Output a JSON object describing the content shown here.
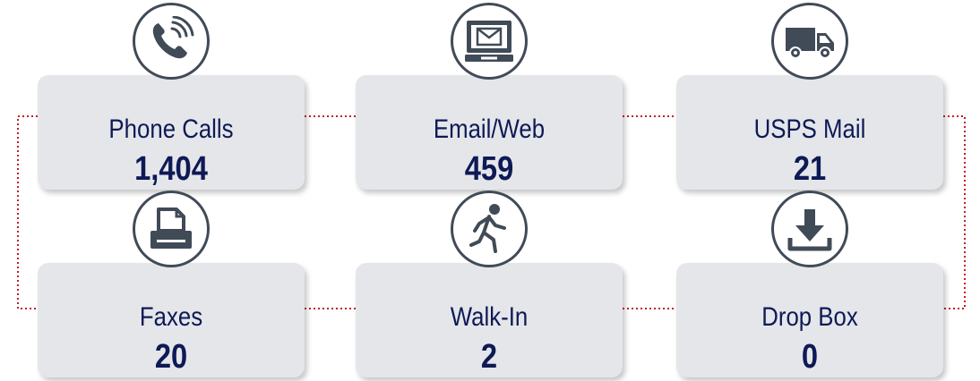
{
  "colors": {
    "card_background": "#e5e6ea",
    "text": "#0d1a55",
    "icon": "#414b57",
    "connector": "#c0202a"
  },
  "channels": [
    {
      "label": "Phone Calls",
      "value": "1,404",
      "icon": "phone-icon"
    },
    {
      "label": "Email/Web",
      "value": "459",
      "icon": "email-monitor-icon"
    },
    {
      "label": "USPS Mail",
      "value": "21",
      "icon": "delivery-van-icon"
    },
    {
      "label": "Faxes",
      "value": "20",
      "icon": "fax-printer-icon"
    },
    {
      "label": "Walk-In",
      "value": "2",
      "icon": "walking-person-icon"
    },
    {
      "label": "Drop Box",
      "value": "0",
      "icon": "download-tray-icon"
    }
  ]
}
